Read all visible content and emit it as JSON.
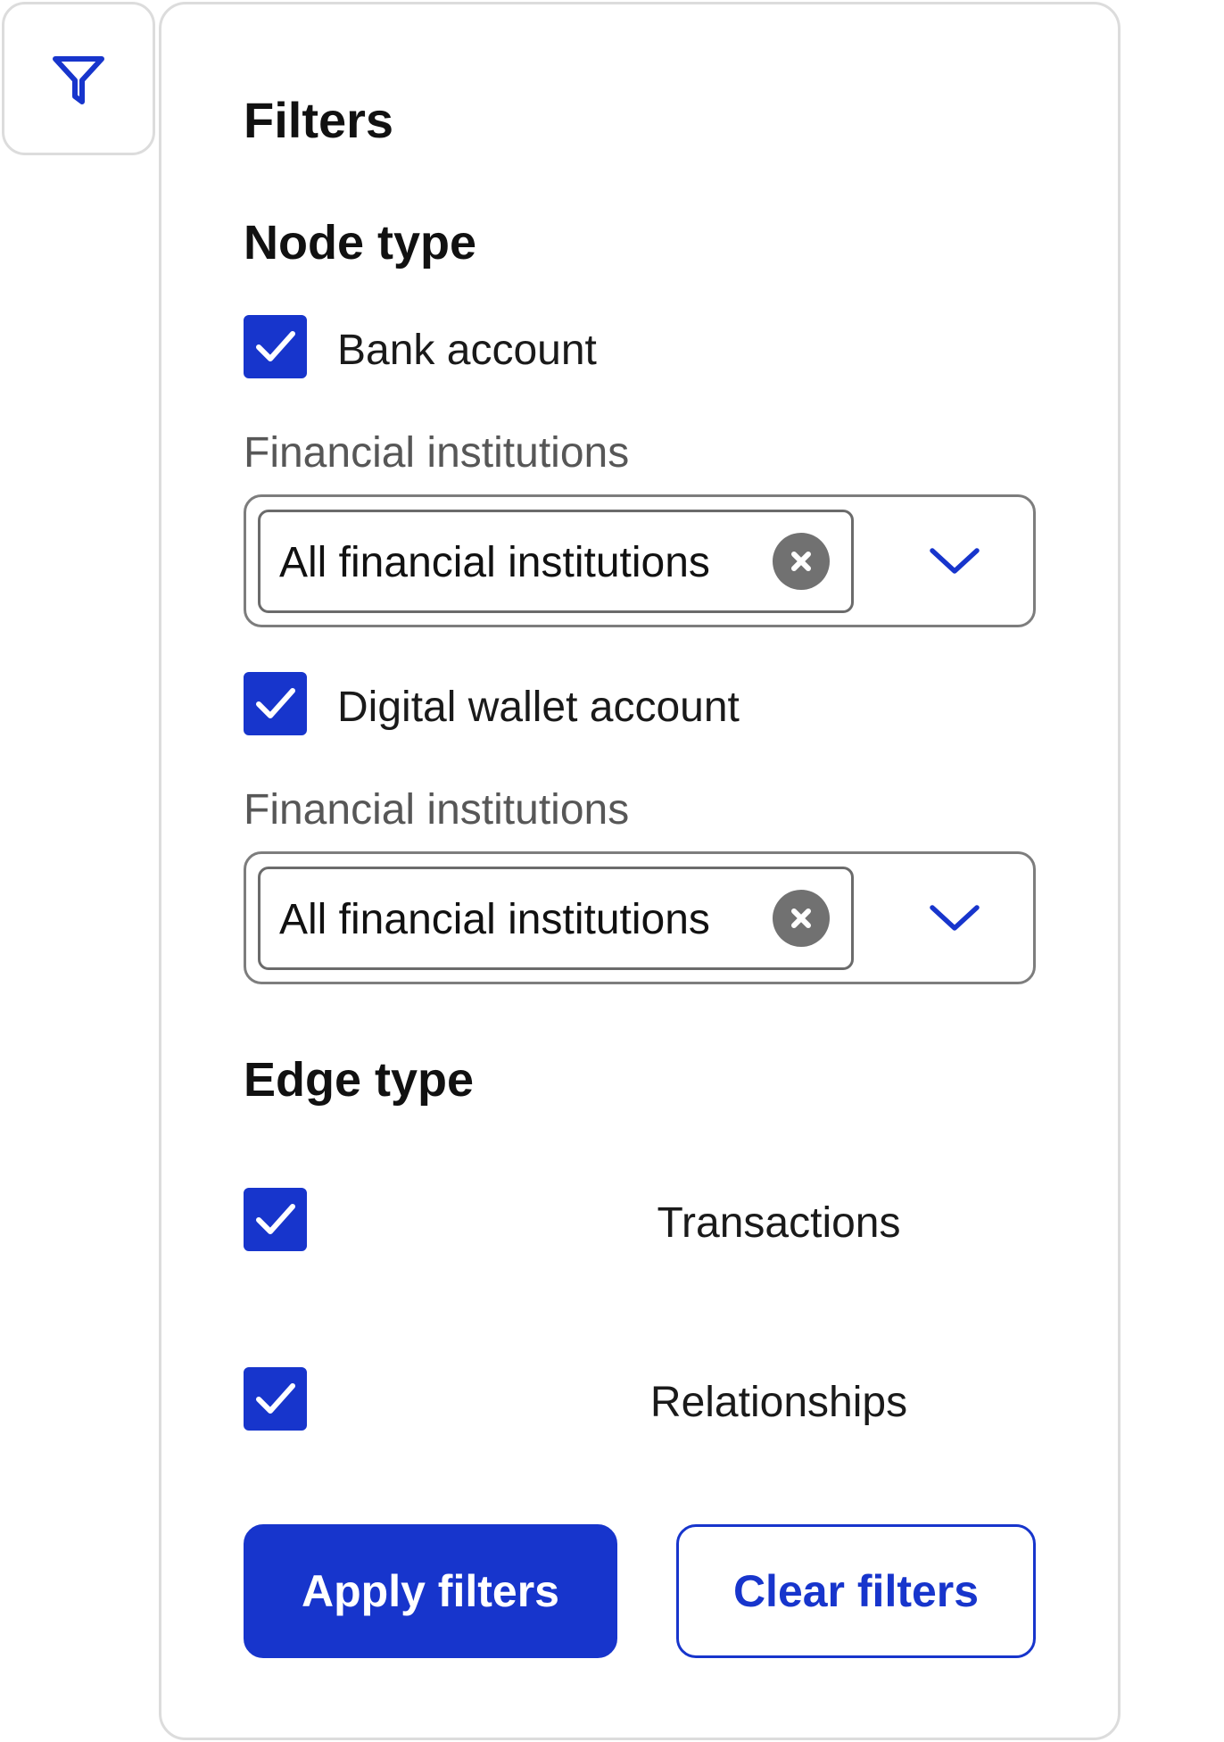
{
  "filter_toggle": {
    "icon": "filter-icon"
  },
  "panel": {
    "title": "Filters",
    "node_type": {
      "heading": "Node type",
      "options": [
        {
          "label": "Bank account",
          "checked": true,
          "field_label": "Financial institutions",
          "selected_value": "All financial institutions",
          "clear_icon": "clear-icon",
          "dropdown_icon": "chevron-down-icon"
        },
        {
          "label": "Digital wallet account",
          "checked": true,
          "field_label": "Financial institutions",
          "selected_value": "All financial institutions",
          "clear_icon": "clear-icon",
          "dropdown_icon": "chevron-down-icon"
        }
      ]
    },
    "edge_type": {
      "heading": "Edge type",
      "options": [
        {
          "label": "Transactions",
          "checked": true
        },
        {
          "label": "Relationships",
          "checked": true
        }
      ]
    },
    "actions": {
      "apply_label": "Apply filters",
      "clear_label": "Clear filters"
    }
  },
  "icons": {
    "checkbox_mark": "check-icon"
  },
  "colors": {
    "accent": "#1735cc",
    "text": "#111111",
    "muted_text": "#575757",
    "field_border": "#7d7d7d",
    "clear_icon": "#717171",
    "panel_border": "#dcdcdc",
    "background": "#ffffff"
  }
}
